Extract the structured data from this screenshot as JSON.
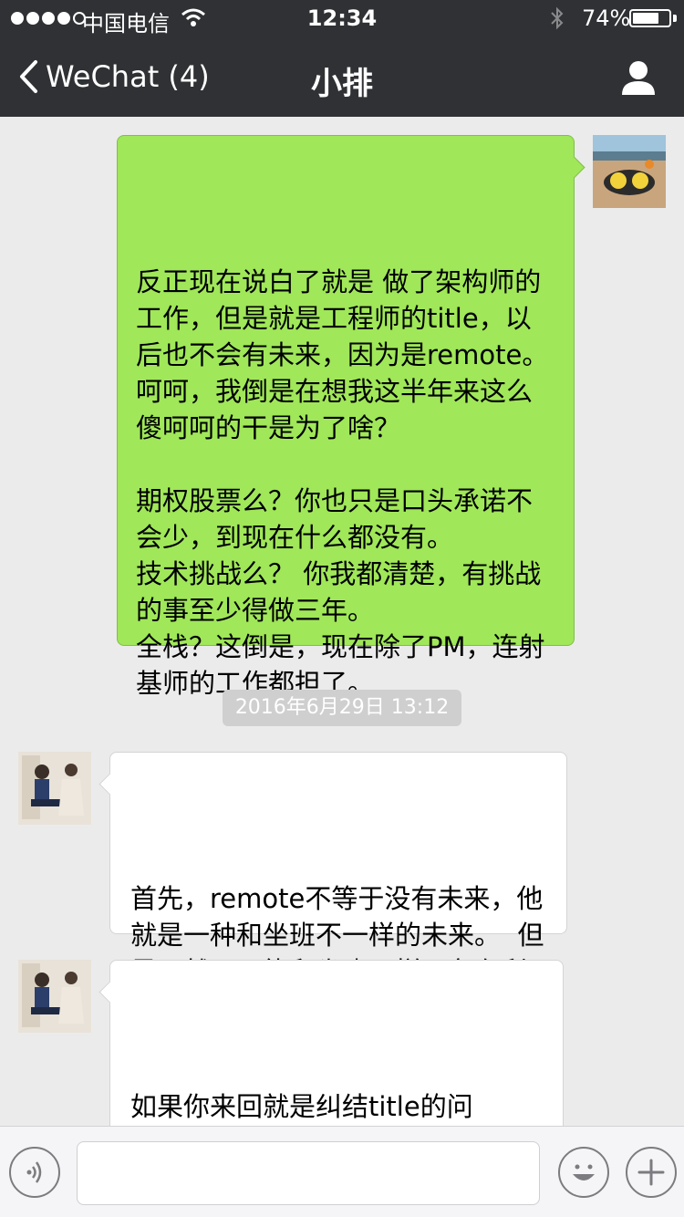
{
  "status_bar": {
    "carrier": "中国电信",
    "time": "12:34",
    "battery_percent": "74%",
    "battery_level": 0.74,
    "signal_bars": 4
  },
  "nav": {
    "back_label": "WeChat (4)",
    "title": "小排",
    "back_icon": "chevron-left-icon",
    "profile_icon": "person-icon"
  },
  "messages": [
    {
      "direction": "out",
      "text": "反正现在说白了就是 做了架构师的工作，但是就是工程师的title，以后也不会有未来，因为是remote。呵呵，我倒是在想我这半年来这么傻呵呵的干是为了啥？\n\n期权股票么？你也只是口头承诺不会少，到现在什么都没有。\n技术挑战么？ 你我都清楚，有挑战的事至少得做三年。\n全栈？这倒是，现在除了PM，连射基师的工作都担了。"
    },
    {
      "direction": "in",
      "text": "首先，remote不等于没有未来，他就是一种和坐班不一样的未来。  但是显然不可能和坐班一样，各有利弊的事情。"
    },
    {
      "direction": "in",
      "text": "如果你来回就是纠结title的问题。。。随便你想叫什么，你叫架构师就是架构师，有什么关系。我们内部也没有任何地方用"
    }
  ],
  "timestamp": "2016年6月29日 13:12",
  "input_bar": {
    "voice_icon": "voice-icon",
    "emoji_icon": "emoji-icon",
    "plus_icon": "plus-icon",
    "message_value": ""
  },
  "colors": {
    "nav_bg": "#2f3134",
    "chat_bg": "#ebebeb",
    "outgoing_bubble": "#a0e759",
    "incoming_bubble": "#ffffff"
  }
}
